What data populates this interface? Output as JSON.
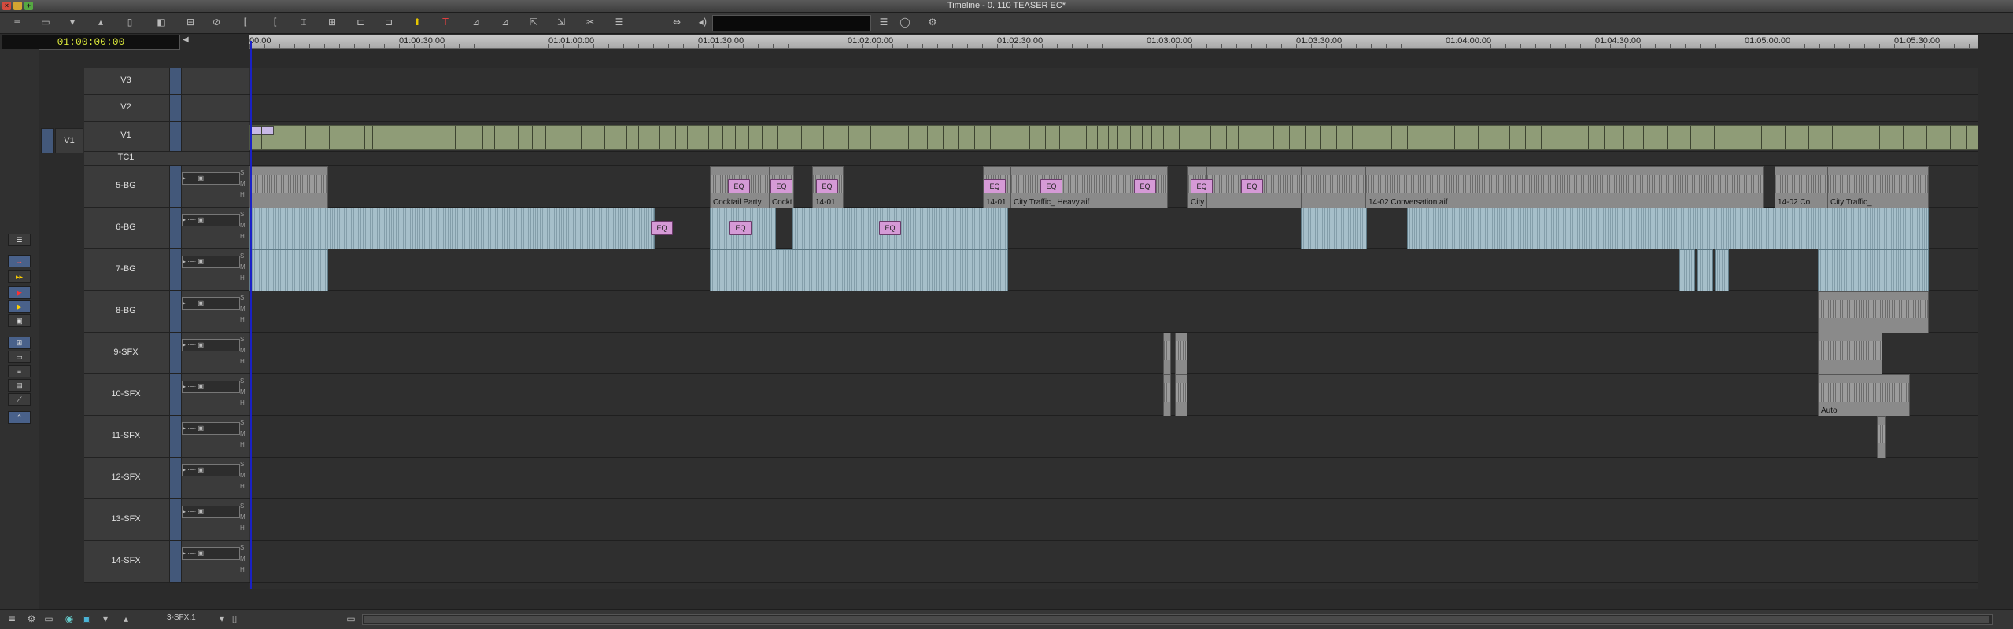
{
  "window": {
    "title": "Timeline - 0. 110 TEASER EC*"
  },
  "timecode": {
    "current": "01:00:00:00"
  },
  "ruler": {
    "labels": [
      "00:00",
      "01:00:30:00",
      "01:01:00:00",
      "01:01:30:00",
      "01:02:00:00",
      "01:02:30:00",
      "01:03:00:00",
      "01:03:30:00",
      "01:04:00:00",
      "01:04:30:00",
      "01:05:00:00",
      "01:05:30:00"
    ]
  },
  "tracks": {
    "video": [
      {
        "name": "V3"
      },
      {
        "name": "V2"
      },
      {
        "name": "V1",
        "monitor": "V1"
      }
    ],
    "tc": {
      "name": "TC1"
    },
    "audio": [
      {
        "name": "5-BG"
      },
      {
        "name": "6-BG"
      },
      {
        "name": "7-BG"
      },
      {
        "name": "8-BG"
      },
      {
        "name": "9-SFX"
      },
      {
        "name": "10-SFX"
      },
      {
        "name": "11-SFX"
      },
      {
        "name": "12-SFX"
      },
      {
        "name": "13-SFX"
      },
      {
        "name": "14-SFX"
      }
    ]
  },
  "clips": {
    "bg5": [
      {
        "label": "Cocktail Party"
      },
      {
        "label": "Cockt"
      },
      {
        "label": "14-01"
      },
      {
        "label": "14-01"
      },
      {
        "label": "City Traffic_ Heavy.aif"
      },
      {
        "label": "City"
      },
      {
        "label": "14-02 Conversation.aif"
      },
      {
        "label": "14-02 Co"
      },
      {
        "label": "City Traffic_"
      }
    ],
    "sfx10": [
      {
        "label": "Auto"
      }
    ]
  },
  "effects": {
    "eq_label": "EQ"
  },
  "bottom": {
    "track_selector": "3-SFX.1"
  },
  "colors": {
    "audio_clip": "#a6bfca",
    "video_clip": "#8f9c77",
    "effect": "#d59ad6",
    "playhead": "#1a21c6",
    "timecode": "#d8e53a"
  }
}
